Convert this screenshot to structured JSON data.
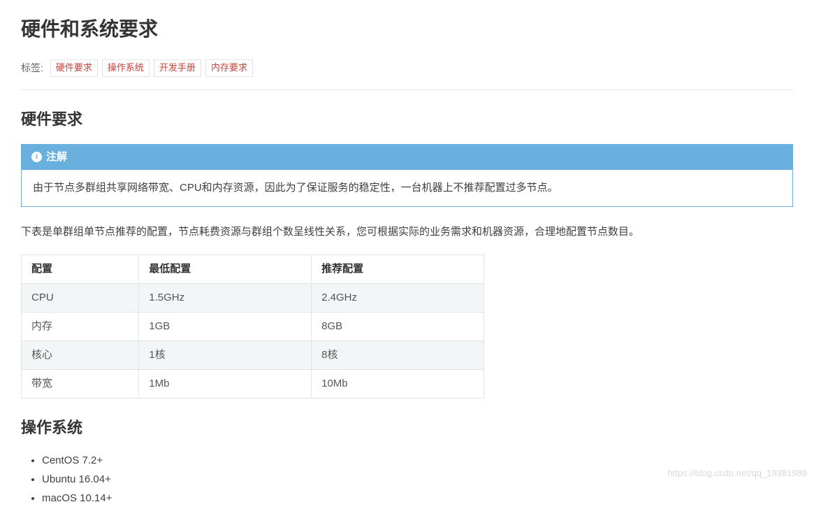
{
  "page": {
    "title": "硬件和系统要求",
    "tags_label": "标签:",
    "tags": [
      "硬件要求",
      "操作系统",
      "开发手册",
      "内存要求"
    ]
  },
  "section_hardware": {
    "title": "硬件要求",
    "note_title": "注解",
    "note_body": "由于节点多群组共享网络带宽、CPU和内存资源，因此为了保证服务的稳定性，一台机器上不推荐配置过多节点。",
    "intro": "下表是单群组单节点推荐的配置，节点耗费资源与群组个数呈线性关系，您可根据实际的业务需求和机器资源，合理地配置节点数目。",
    "table": {
      "headers": [
        "配置",
        "最低配置",
        "推荐配置"
      ],
      "rows": [
        [
          "CPU",
          "1.5GHz",
          "2.4GHz"
        ],
        [
          "内存",
          "1GB",
          "8GB"
        ],
        [
          "核心",
          "1核",
          "8核"
        ],
        [
          "带宽",
          "1Mb",
          "10Mb"
        ]
      ]
    }
  },
  "section_os": {
    "title": "操作系统",
    "items": [
      "CentOS 7.2+",
      "Ubuntu 16.04+",
      "macOS 10.14+"
    ]
  },
  "watermark": "https://blog.csdn.net/qq_19381989"
}
